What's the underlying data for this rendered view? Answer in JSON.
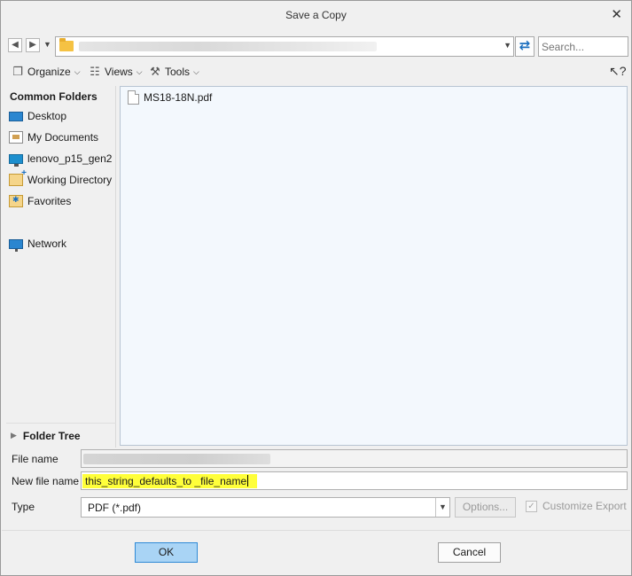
{
  "window": {
    "title": "Save a Copy"
  },
  "navigation": {
    "path": "",
    "search_placeholder": "Search..."
  },
  "toolbar": {
    "organize_label": "Organize",
    "views_label": "Views",
    "tools_label": "Tools"
  },
  "sidebar": {
    "heading": "Common Folders",
    "items": [
      {
        "label": "Desktop",
        "icon": "desktop-icon"
      },
      {
        "label": "My Documents",
        "icon": "documents-icon"
      },
      {
        "label": "lenovo_p15_gen2",
        "icon": "computer-icon"
      },
      {
        "label": "Working Directory",
        "icon": "working-directory-icon"
      },
      {
        "label": "Favorites",
        "icon": "favorites-icon"
      },
      {
        "label": "Network",
        "icon": "network-icon"
      }
    ],
    "folder_tree_label": "Folder Tree"
  },
  "files": [
    {
      "name": "MS18-18N.pdf",
      "icon": "pdf-file-icon"
    }
  ],
  "form": {
    "file_name_label": "File name",
    "file_name_value": "",
    "new_file_name_label": "New file name",
    "new_file_name_value": "this_string_defaults_to _file_name",
    "type_label": "Type",
    "type_value": "PDF (*.pdf)",
    "options_label": "Options...",
    "customize_export_label": "Customize Export"
  },
  "buttons": {
    "ok_label": "OK",
    "cancel_label": "Cancel"
  },
  "colors": {
    "ok_button_bg": "#a9d4f5",
    "highlight": "#ffff3a",
    "file_list_bg": "#f3f8fd"
  }
}
